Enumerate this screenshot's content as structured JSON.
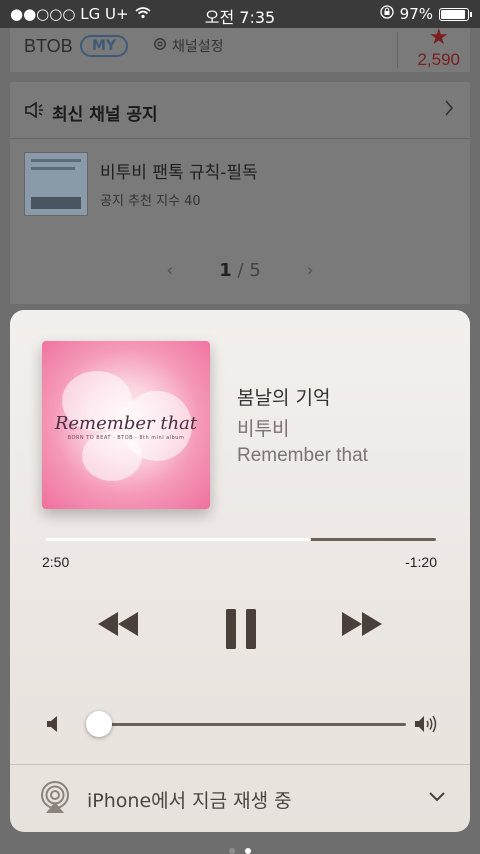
{
  "status_bar": {
    "carrier": "●●○○○ LG U+",
    "time": "오전 7:35",
    "battery_pct": "97%"
  },
  "background_app": {
    "brand": "BTOB",
    "my_badge": "MY",
    "channel_settings": "채널설정",
    "star_count": "2,590",
    "notice_section_title": "최신 채널 공지",
    "notice_item": {
      "title": "비투비 팬톡 규칙-필독",
      "meta": "공지 추천 지수 40"
    },
    "pager": {
      "current": "1",
      "separator": "/",
      "total": "5"
    }
  },
  "now_playing": {
    "artwork_title": "Remember that",
    "artwork_subtitle": "BORN TO BEAT · BTOB · 8th mini album",
    "song_title": "봄날의 기억",
    "artist": "비투비",
    "album": "Remember that",
    "elapsed": "2:50",
    "remaining": "-1:20",
    "progress": 0.68,
    "volume": 0.04,
    "route_label": "iPhone에서 지금 재생 중"
  },
  "colors": {
    "accent_star": "#7a1e1e",
    "control_dark": "#4a403b",
    "dot_active": "#ffffff",
    "dot_inactive": "#8e8e8e"
  },
  "icons": {
    "rewind": "rewind-icon",
    "pause": "pause-icon",
    "fast_forward": "fast-forward-icon",
    "volume_low": "volume-low-icon",
    "volume_high": "volume-high-icon",
    "airplay": "airplay-icon",
    "chevron_down": "chevron-down-icon"
  },
  "page_dots": {
    "count": 2,
    "active": 1
  }
}
